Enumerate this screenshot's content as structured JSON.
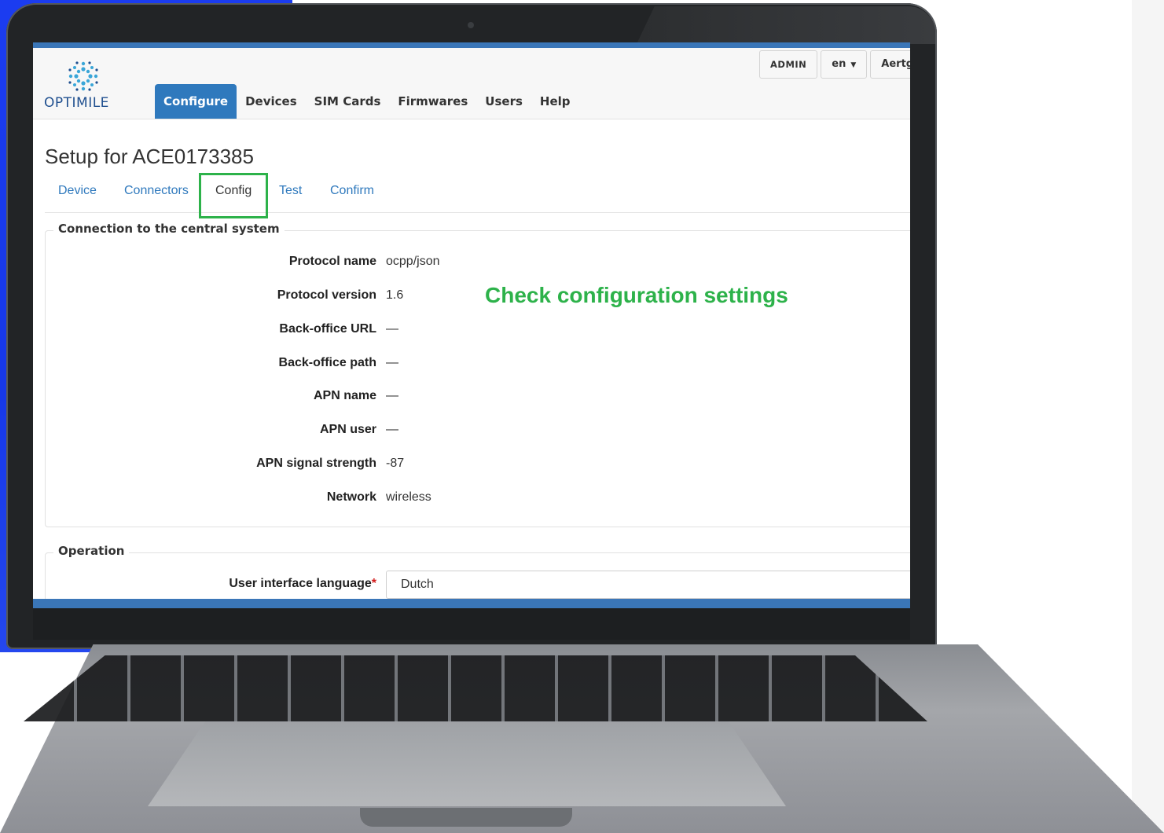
{
  "brand": {
    "logo_text": "OPTIMILE"
  },
  "header": {
    "nav_tabs": [
      {
        "label": "Configure",
        "active": true
      },
      {
        "label": "Devices"
      },
      {
        "label": "SIM Cards"
      },
      {
        "label": "Firmwares"
      },
      {
        "label": "Users"
      },
      {
        "label": "Help"
      }
    ],
    "role_badge": "ADMIN",
    "language": "en",
    "user_name": "Aertg"
  },
  "page": {
    "title": "Setup for ACE0173385",
    "tabs": [
      {
        "label": "Device"
      },
      {
        "label": "Connectors"
      },
      {
        "label": "Config",
        "active": true
      },
      {
        "label": "Test"
      },
      {
        "label": "Confirm"
      }
    ]
  },
  "connection": {
    "legend": "Connection to the central system",
    "fields": [
      {
        "label": "Protocol name",
        "value": "ocpp/json"
      },
      {
        "label": "Protocol version",
        "value": "1.6"
      },
      {
        "label": "Back-office URL",
        "value": "—"
      },
      {
        "label": "Back-office path",
        "value": "—"
      },
      {
        "label": "APN name",
        "value": "—"
      },
      {
        "label": "APN user",
        "value": "—"
      },
      {
        "label": "APN signal strength",
        "value": "-87"
      },
      {
        "label": "Network",
        "value": "wireless"
      }
    ]
  },
  "operation": {
    "legend": "Operation",
    "ui_language_label": "User interface language",
    "required_mark": "*",
    "ui_language_value": "Dutch"
  },
  "annotation": {
    "text": "Check configuration settings",
    "color": "#2db24a"
  },
  "colors": {
    "accent": "#2f79bd",
    "highlight": "#2db24a",
    "background_left": "#1b3cf0"
  }
}
